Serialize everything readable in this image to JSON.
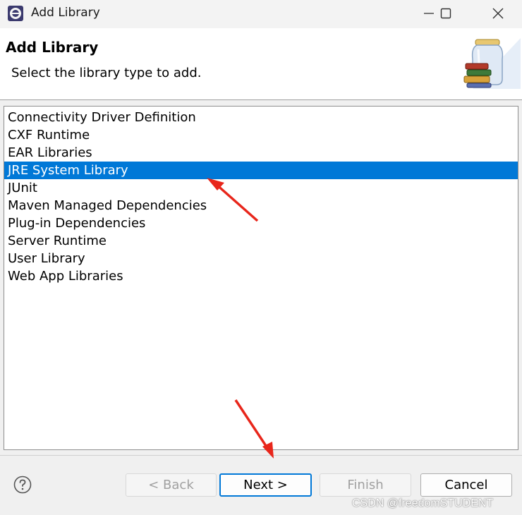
{
  "window": {
    "title": "Add Library",
    "icons": {
      "app": "eclipse-icon",
      "minimize": "minimize-icon",
      "maximize": "maximize-icon",
      "close": "close-icon"
    }
  },
  "header": {
    "title": "Add Library",
    "description": "Select the library type to add.",
    "image": "library-jar-books-icon"
  },
  "list": {
    "items": [
      "Connectivity Driver Definition",
      "CXF Runtime",
      "EAR Libraries",
      "JRE System Library",
      "JUnit",
      "Maven Managed Dependencies",
      "Plug-in Dependencies",
      "Server Runtime",
      "User Library",
      "Web App Libraries"
    ],
    "selected": "JRE System Library",
    "selection_color": "#0078d7"
  },
  "footer": {
    "help_icon": "help-icon",
    "buttons": {
      "back": "< Back",
      "next": "Next >",
      "finish": "Finish",
      "cancel": "Cancel"
    }
  },
  "annotations": {
    "arrow_color": "#e8261b"
  },
  "watermark": "CSDN @freedomSTUDENT"
}
